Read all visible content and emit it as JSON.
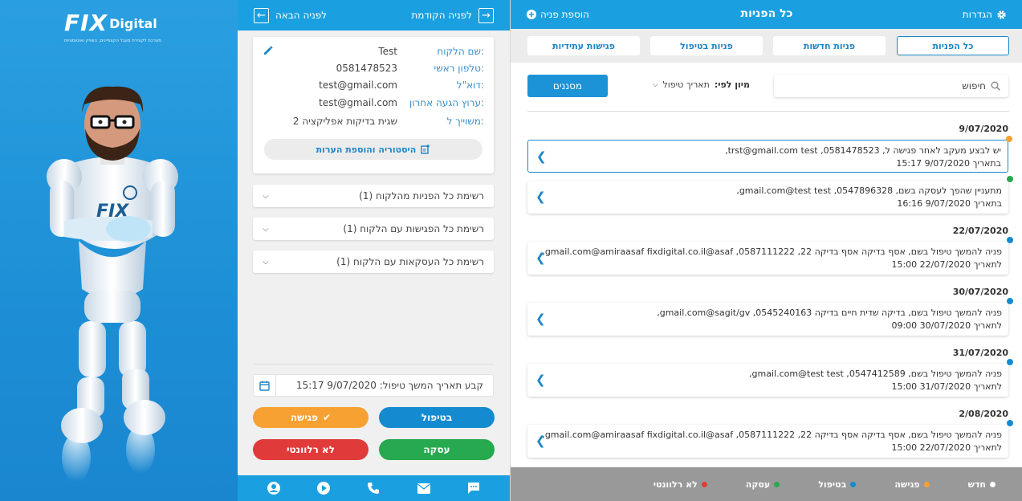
{
  "brand": {
    "logo_mark": "FIX",
    "logo_word": "Digital",
    "tagline": "מערכת לקצירת מעגל הקצפיינים, השויק ואוטומציות"
  },
  "client_nav": {
    "next_label": "לפניה הבאה",
    "prev_label": "לפניה הקודמת"
  },
  "client": {
    "fields": [
      {
        "label": "שם הלקוח:",
        "value": "Test"
      },
      {
        "label": "טלפון ראשי:",
        "value": "0581478523"
      },
      {
        "label": "דוא\"ל:",
        "value": "test@gmail.com"
      },
      {
        "label": "ערוץ הגעה אחרון:",
        "value": "test@gmail.com"
      },
      {
        "label": "משוייך ל:",
        "value": "שגית בדיקות אפליקציה 2"
      }
    ],
    "history_button": "היסטוריה והוספת הערות"
  },
  "accordions": [
    "רשימת כל הפניות מהלקוח (1)",
    "רשימת כל הפגישות עם הלקוח (1)",
    "רשימת כל העסקאות עם הלקוח (1)"
  ],
  "followup": {
    "text": "קבע תאריך המשך טיפול: 9/07/2020 15:17"
  },
  "actions": {
    "treatment": "בטיפול",
    "meeting": "פגישה",
    "deal": "עסקה",
    "irrelevant": "לא רלוונטי"
  },
  "bottom_icons": [
    "user-circle-icon",
    "play-icon",
    "phone-icon",
    "mail-icon",
    "chat-icon"
  ],
  "leads_header": {
    "title": "כל הפניות",
    "settings": "הגדרות",
    "add": "הוספת פניה"
  },
  "tabs": [
    "כל הפניות",
    "פניות חדשות",
    "פניות בטיפול",
    "פגישות עתידיות"
  ],
  "search": {
    "placeholder": "חיפוש"
  },
  "sort": {
    "label": "מיון לפי:",
    "value": "תאריך טיפול"
  },
  "filters_label": "מסננים",
  "lead_groups": [
    {
      "date": "9/07/2020",
      "leads": [
        {
          "line1": "יש לבצע מעקב לאחר פגישה ל, 0581478523, trst@gmail.com test,",
          "line2": "בתאריך 9/07/2020 15:17",
          "color": "#f7a133",
          "selected": true
        },
        {
          "line1": "מתעניין שהפך לעסקה בשם, 0547896328, gmail.com@test test,",
          "line2": "בתאריך 9/07/2020 16:16",
          "color": "#26a94f",
          "selected": false
        }
      ]
    },
    {
      "date": "22/07/2020",
      "leads": [
        {
          "line1": "פניה להמשך טיפול בשם, אסף בדיקה אסף בדיקה 22, 0587111222, gmail.com@amiraasaf fixdigital.co.il@asaf,",
          "line2": "לתאריך 22/07/2020 15:00",
          "color": "#148bd0",
          "selected": false
        }
      ]
    },
    {
      "date": "30/07/2020",
      "leads": [
        {
          "line1": "פניה להמשך טיפול בשם, בדיקה שדית חיים בדיקה 0545240163, gmail.com@sagit/gv,",
          "line2": "לתאריך 30/07/2020 09:00",
          "color": "#148bd0",
          "selected": false
        }
      ]
    },
    {
      "date": "31/07/2020",
      "leads": [
        {
          "line1": "פניה להמשך טיפול בשם, 0547412589, gmail.com@test test,",
          "line2": "לתאריך 31/07/2020 15:00",
          "color": "#148bd0",
          "selected": false
        }
      ]
    },
    {
      "date": "2/08/2020",
      "leads": [
        {
          "line1": "פניה להמשך טיפול בשם, אסף בדיקה אסף בדיקה 22, 0587111222, gmail.com@amiraasaf fixdigital.co.il@asaf,",
          "line2": "לתאריך 22/07/2020 15:00",
          "color": "#148bd0",
          "selected": false
        }
      ]
    }
  ],
  "legend": [
    {
      "label": "חדש",
      "color": "#ffffff"
    },
    {
      "label": "פגישה",
      "color": "#f7a133"
    },
    {
      "label": "בטיפול",
      "color": "#148bd0"
    },
    {
      "label": "עסקה",
      "color": "#26a94f"
    },
    {
      "label": "לא רלוונטי",
      "color": "#e13a3a"
    }
  ]
}
